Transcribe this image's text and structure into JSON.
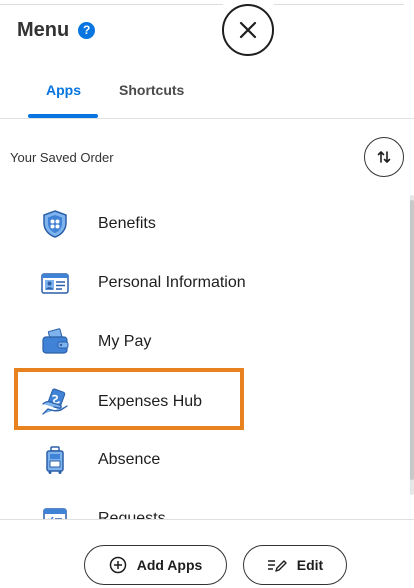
{
  "header": {
    "title": "Menu",
    "help_icon": "?",
    "close_icon": "close-icon"
  },
  "tabs": [
    {
      "label": "Apps",
      "active": true
    },
    {
      "label": "Shortcuts",
      "active": false
    }
  ],
  "saved_order": {
    "label": "Your Saved Order",
    "sort_icon": "sort-arrows-icon"
  },
  "apps": [
    {
      "label": "Benefits",
      "icon": "benefits-shield-icon"
    },
    {
      "label": "Personal Information",
      "icon": "id-card-icon"
    },
    {
      "label": "My Pay",
      "icon": "wallet-icon"
    },
    {
      "label": "Expenses Hub",
      "icon": "expenses-hand-icon",
      "highlighted": true
    },
    {
      "label": "Absence",
      "icon": "luggage-icon"
    },
    {
      "label": "Requests",
      "icon": "clipboard-icon"
    }
  ],
  "footer": {
    "add_apps_label": "Add Apps",
    "edit_label": "Edit"
  },
  "colors": {
    "accent": "#0875e1",
    "highlight": "#e8821e"
  }
}
